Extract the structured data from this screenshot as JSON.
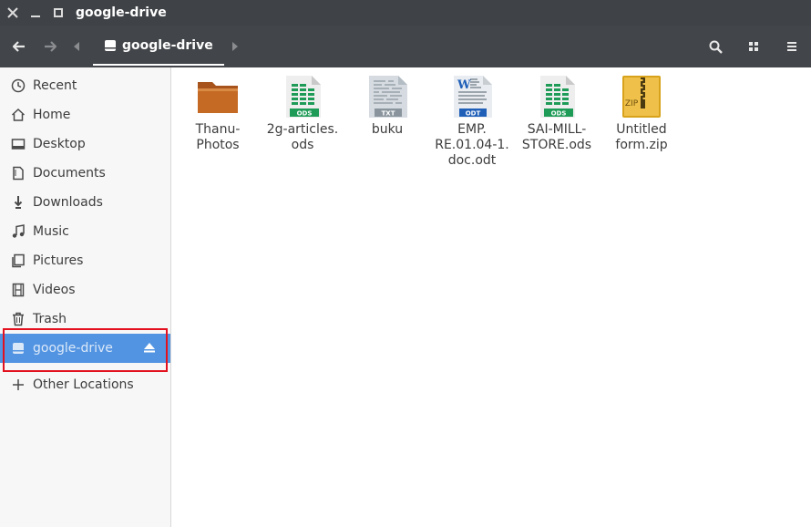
{
  "window": {
    "title": "google-drive"
  },
  "path": {
    "current": "google-drive"
  },
  "sidebar": {
    "items": [
      {
        "label": "Recent"
      },
      {
        "label": "Home"
      },
      {
        "label": "Desktop"
      },
      {
        "label": "Documents"
      },
      {
        "label": "Downloads"
      },
      {
        "label": "Music"
      },
      {
        "label": "Pictures"
      },
      {
        "label": "Videos"
      },
      {
        "label": "Trash"
      },
      {
        "label": "google-drive"
      },
      {
        "label": "Other Locations"
      }
    ]
  },
  "files": [
    {
      "name": "Thanu-\nPhotos",
      "icon": "folder-icon"
    },
    {
      "name": "2g-articles.\nods",
      "icon": "spreadsheet-icon",
      "badge": "ODS"
    },
    {
      "name": "buku",
      "icon": "text-file-icon",
      "badge": "TXT"
    },
    {
      "name": "EMP.\nRE.01.04-1.\ndoc.odt",
      "icon": "document-icon",
      "badge": "ODT"
    },
    {
      "name": "SAI-MILL-\nSTORE.ods",
      "icon": "spreadsheet-icon",
      "badge": "ODS"
    },
    {
      "name": "Untitled\nform.zip",
      "icon": "zip-icon",
      "badge": "ZIP"
    }
  ],
  "colors": {
    "accent": "#5294e2",
    "titlebar": "#3f4246",
    "headerbar": "#424549",
    "highlight": "#e3101e"
  }
}
